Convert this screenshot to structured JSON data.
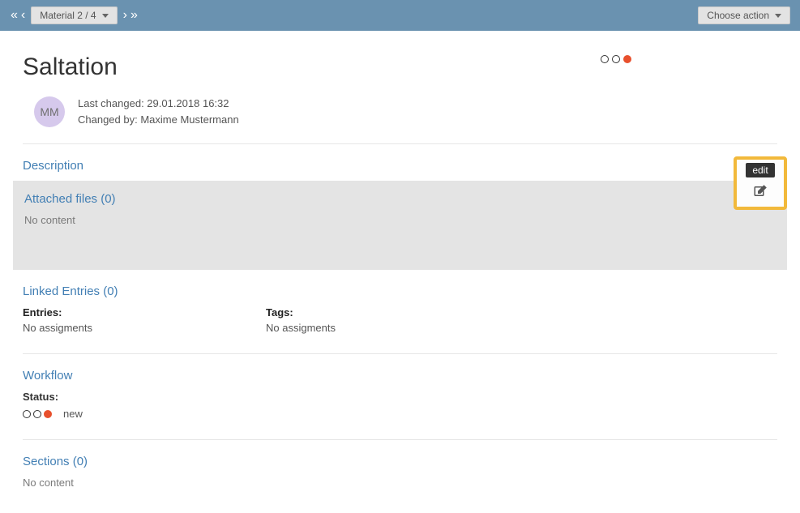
{
  "topbar": {
    "material_label": "Material 2 / 4",
    "choose_action_label": "Choose action"
  },
  "title": "Saltation",
  "meta": {
    "avatar_initials": "MM",
    "last_changed": "Last changed: 29.01.2018 16:32",
    "changed_by": "Changed by: Maxime Mustermann"
  },
  "description": {
    "heading": "Description"
  },
  "attached": {
    "heading": "Attached files (0)",
    "no_content": "No content",
    "edit_tooltip": "edit"
  },
  "linked": {
    "heading": "Linked Entries (0)",
    "entries_label": "Entries:",
    "entries_value": "No assigments",
    "tags_label": "Tags:",
    "tags_value": "No assigments"
  },
  "workflow": {
    "heading": "Workflow",
    "status_label": "Status:",
    "status_value": "new"
  },
  "sections": {
    "heading": "Sections (0)",
    "no_content": "No content"
  }
}
